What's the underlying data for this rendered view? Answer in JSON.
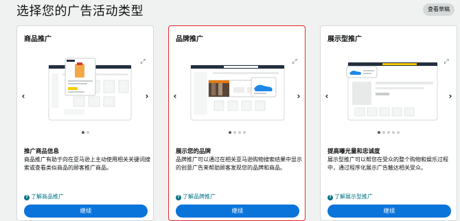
{
  "header": {
    "title": "选择您的广告活动类型",
    "drafts_button": "查看草稿"
  },
  "cards": [
    {
      "title": "商品推广",
      "selected": false,
      "carousel": {
        "total_slides": 2,
        "active_index": 0
      },
      "description_title": "推广商品信息",
      "description": "商品推广有助于向在亚马逊上主动使用相关关键词搜索或查看类似商品的顾客推广商品。",
      "learn_more": "了解商品推广",
      "continue": "继续"
    },
    {
      "title": "品牌推广",
      "selected": true,
      "carousel": {
        "total_slides": 4,
        "active_index": 0
      },
      "description_title": "展示您的品牌",
      "description": "品牌推广可以通过在相关亚马逊购物搜索结果中显示的创意广告来帮助顾客发现您的品牌和商品。",
      "learn_more": "了解品牌推广",
      "continue": "继续"
    },
    {
      "title": "展示型推广",
      "selected": false,
      "carousel": {
        "total_slides": 5,
        "active_index": 0
      },
      "description_title": "提高曝光量和忠诚度",
      "description": "展示型推广可以帮您在受众的整个购物和娱乐过程中，通过程序化展示广告触达相关受众。",
      "learn_more": "了解展示型推广",
      "continue": "继续"
    }
  ],
  "colors": {
    "primary_button": "#0a74da",
    "link": "#007185",
    "selected_border": "#e3252b",
    "background": "#f0f2f2",
    "accent_orange": "#e47911"
  },
  "icons": {
    "expand": "expand-icon",
    "prev": "chevron-left-icon",
    "next": "chevron-right-icon",
    "help": "question-circle-icon"
  }
}
